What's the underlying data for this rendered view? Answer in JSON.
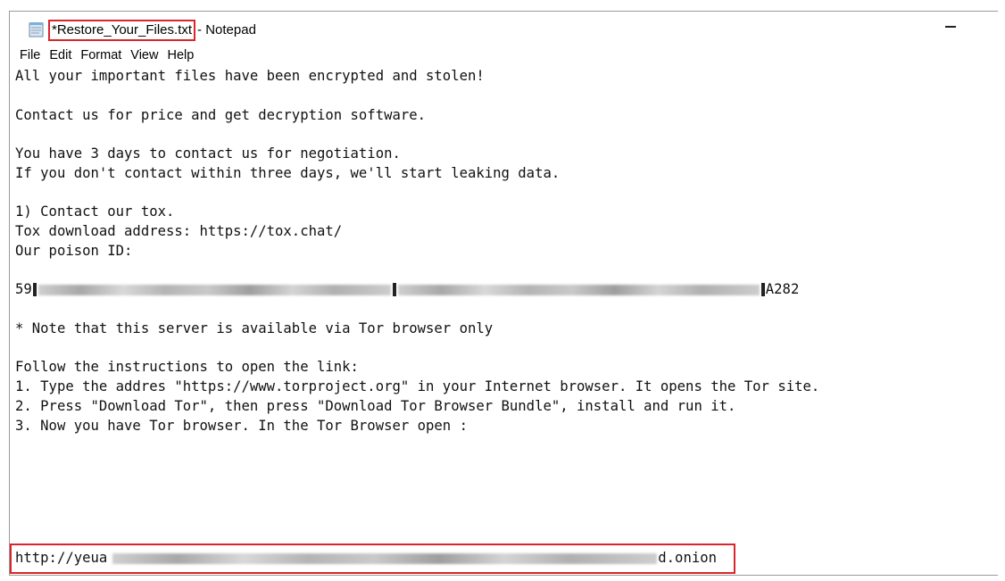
{
  "window": {
    "title_file": "*Restore_Your_Files.txt",
    "title_app": "- Notepad",
    "icon": "notepad-icon",
    "highlight_color": "#d9262c"
  },
  "menu": [
    "File",
    "Edit",
    "Format",
    "View",
    "Help"
  ],
  "content": {
    "line1": "All your important files have been encrypted and stolen!",
    "line2": "Contact us for price and get decryption software.",
    "line3": "You have 3 days to contact us for negotiation.",
    "line4": "If you don't contact within three days, we'll start leaking data.",
    "line5": "1) Contact our tox.",
    "line6": "Tox download address: https://tox.chat/",
    "line7": "Our poison ID:",
    "id_prefix": "59",
    "id_suffix": "A282",
    "line9": "* Note that this server is available via Tor browser only",
    "line10": "Follow the instructions to open the link:",
    "line11": "1. Type the addres \"https://www.torproject.org\" in your Internet browser. It opens the Tor site.",
    "line12": "2. Press \"Download Tor\", then press \"Download Tor Browser Bundle\", install and run it.",
    "line13": "3. Now you have Tor browser. In the Tor Browser open :",
    "url_prefix": "http://yeua",
    "url_suffix": "d.onion"
  }
}
